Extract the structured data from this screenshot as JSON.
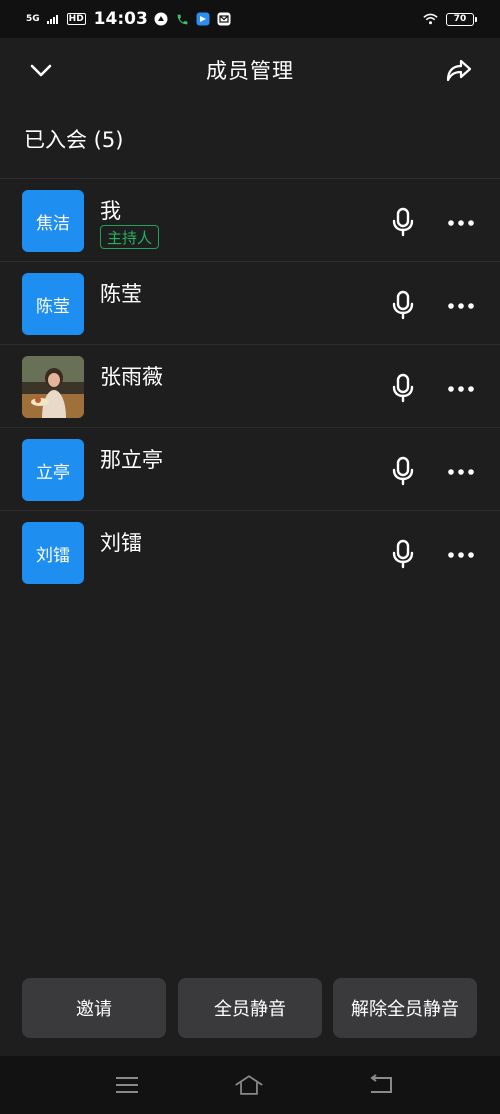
{
  "status_bar": {
    "network": "5G",
    "hd": "HD",
    "time": "14:03",
    "battery": "70",
    "icons": [
      "signal-icon",
      "app-icon",
      "phone-icon",
      "app2-icon",
      "mail-icon",
      "wifi-icon",
      "battery-icon"
    ]
  },
  "header": {
    "title": "成员管理",
    "back_icon": "chevron-down-icon",
    "share_icon": "share-icon"
  },
  "section": {
    "title": "已入会 (5)"
  },
  "members": [
    {
      "avatar_text": "焦洁",
      "name": "我",
      "role": "主持人",
      "mic_icon": "microphone-icon",
      "more_icon": "more-icon"
    },
    {
      "avatar_text": "陈莹",
      "name": "陈莹",
      "role": "",
      "mic_icon": "microphone-icon",
      "more_icon": "more-icon"
    },
    {
      "avatar_text": "",
      "name": "张雨薇",
      "role": "",
      "mic_icon": "microphone-icon",
      "more_icon": "more-icon",
      "avatar_type": "photo"
    },
    {
      "avatar_text": "立亭",
      "name": "那立亭",
      "role": "",
      "mic_icon": "microphone-icon",
      "more_icon": "more-icon"
    },
    {
      "avatar_text": "刘镭",
      "name": "刘镭",
      "role": "",
      "mic_icon": "microphone-icon",
      "more_icon": "more-icon"
    }
  ],
  "actions": {
    "invite": "邀请",
    "mute_all": "全员静音",
    "unmute_all": "解除全员静音"
  },
  "colors": {
    "background": "#1e1e1e",
    "avatar_blue": "#1f8ef1",
    "host_badge_green": "#21b45f",
    "button_bg": "#3a3a3c"
  }
}
